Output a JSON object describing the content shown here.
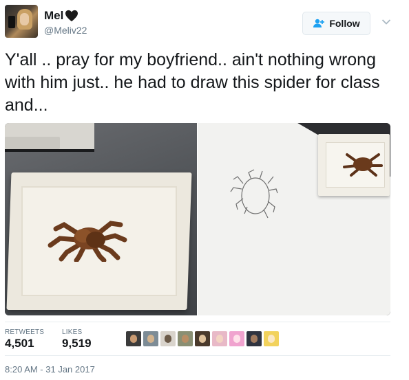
{
  "user": {
    "display_name": "Mel",
    "handle": "@Meliv22"
  },
  "header": {
    "follow_label": "Follow"
  },
  "tweet": {
    "text": "Y'all .. pray for my boyfriend.. ain't nothing wrong with him just.. he had to draw this spider for class and..."
  },
  "stats": {
    "retweets_label": "RETWEETS",
    "retweets_value": "4,501",
    "likes_label": "LIKES",
    "likes_value": "9,519"
  },
  "timestamp": "8:20 AM - 31 Jan 2017",
  "colors": {
    "link_blue": "#1da1f2",
    "text_primary": "#14171a",
    "text_secondary": "#657786",
    "border": "#e6ecf0"
  },
  "icons": {
    "heart": "black-heart-icon",
    "follow": "add-user-icon",
    "menu": "chevron-down-icon"
  }
}
